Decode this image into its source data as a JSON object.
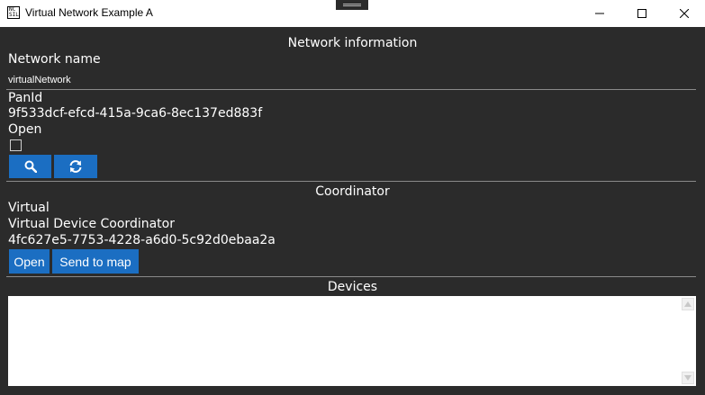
{
  "window": {
    "title": "Virtual Network Example A",
    "icon_text": "NC\nSIL"
  },
  "network": {
    "section_title": "Network information",
    "name_label": "Network name",
    "name_value": "virtualNetwork",
    "panid_label": "PanId",
    "panid_value": "9f533dcf-efcd-415a-9ca6-8ec137ed883f",
    "open_label": "Open",
    "open_checked": false,
    "search_icon": "search-icon",
    "refresh_icon": "refresh-icon"
  },
  "coordinator": {
    "section_title": "Coordinator",
    "type": "Virtual",
    "name": "Virtual Device Coordinator",
    "id": "4fc627e5-7753-4228-a6d0-5c92d0ebaa2a",
    "open_label": "Open",
    "send_label": "Send to map"
  },
  "devices": {
    "section_title": "Devices",
    "items": []
  },
  "colors": {
    "background": "#2b2b2b",
    "accent": "#1b6ec2",
    "titlebar": "#ffffff"
  }
}
